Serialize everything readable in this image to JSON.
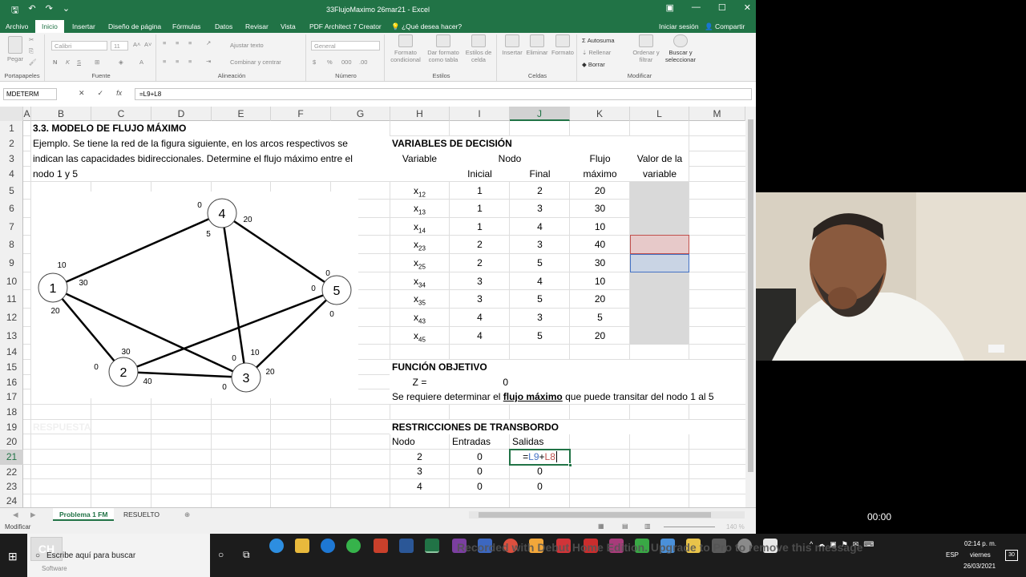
{
  "window": {
    "title": "33FlujoMaximo 26mar21 - Excel",
    "controls": [
      "▣",
      "—",
      "☐",
      "✕"
    ]
  },
  "ribbon_tabs": [
    "Archivo",
    "Inicio",
    "Insertar",
    "Diseño de página",
    "Fórmulas",
    "Datos",
    "Revisar",
    "Vista",
    "PDF Architect 7 Creator",
    "¿Qué desea hacer?"
  ],
  "account": {
    "signin": "Iniciar sesión",
    "share": "Compartir"
  },
  "ribbon": {
    "clipboard": {
      "paste": "Pegar",
      "label": "Portapapeles"
    },
    "font": {
      "name": "Calibri",
      "size": "11",
      "label": "Fuente",
      "bold": "N",
      "italic": "K",
      "underline": "S"
    },
    "alignment": {
      "wrap": "Ajustar texto",
      "merge": "Combinar y centrar",
      "label": "Alineación"
    },
    "number": {
      "format": "General",
      "label": "Número"
    },
    "styles": {
      "conditional": "Formato condicional",
      "as_table": "Dar formato como tabla",
      "cell_styles": "Estilos de celda",
      "label": "Estilos"
    },
    "cells": {
      "insert": "Insertar",
      "delete": "Eliminar",
      "format": "Formato",
      "label": "Celdas"
    },
    "editing": {
      "autosum": "Autosuma",
      "fill": "Rellenar",
      "clear": "Borrar",
      "sort": "Ordenar y filtrar",
      "find": "Buscar y seleccionar",
      "label": "Modificar"
    }
  },
  "formula_bar": {
    "name_box": "MDETERM",
    "fx": "fx",
    "formula": "=L9+L8"
  },
  "columns": [
    "A",
    "B",
    "C",
    "D",
    "E",
    "F",
    "G",
    "H",
    "I",
    "J",
    "K",
    "L",
    "M"
  ],
  "rows": [
    "1",
    "2",
    "3",
    "4",
    "5",
    "6",
    "7",
    "8",
    "9",
    "10",
    "11",
    "12",
    "13",
    "14",
    "15",
    "16",
    "17",
    "18",
    "19",
    "20",
    "21",
    "22",
    "23",
    "24"
  ],
  "sheet": {
    "title": "3.3. MODELO DE FLUJO MÁXIMO",
    "example_l1": "Ejemplo. Se tiene la red de la figura siguiente, en los arcos respectivos se",
    "example_l2": "indican las capacidades bidireccionales. Determine el flujo máximo entre el",
    "example_l3": "nodo 1 y 5",
    "respuesta": "RESPUESTA",
    "vars_title": "VARIABLES DE DECISIÓN",
    "hdr_variable": "Variable",
    "hdr_nodo": "Nodo",
    "hdr_inicial": "Inicial",
    "hdr_final": "Final",
    "hdr_flujo1": "Flujo",
    "hdr_flujo2": "máximo",
    "hdr_valor1": "Valor de la",
    "hdr_valor2": "variable",
    "variables": [
      {
        "name": "x",
        "sub": "12",
        "ini": "1",
        "fin": "2",
        "max": "20"
      },
      {
        "name": "x",
        "sub": "13",
        "ini": "1",
        "fin": "3",
        "max": "30"
      },
      {
        "name": "x",
        "sub": "14",
        "ini": "1",
        "fin": "4",
        "max": "10"
      },
      {
        "name": "x",
        "sub": "23",
        "ini": "2",
        "fin": "3",
        "max": "40"
      },
      {
        "name": "x",
        "sub": "25",
        "ini": "2",
        "fin": "5",
        "max": "30"
      },
      {
        "name": "x",
        "sub": "34",
        "ini": "3",
        "fin": "4",
        "max": "10"
      },
      {
        "name": "x",
        "sub": "35",
        "ini": "3",
        "fin": "5",
        "max": "20"
      },
      {
        "name": "x",
        "sub": "43",
        "ini": "4",
        "fin": "3",
        "max": "5"
      },
      {
        "name": "x",
        "sub": "45",
        "ini": "4",
        "fin": "5",
        "max": "20"
      }
    ],
    "obj_title": "FUNCIÓN OBJETIVO",
    "z_label": "Z =",
    "z_value": "0",
    "requirement_pre": "Se requiere determinar el ",
    "requirement_bold": "flujo máximo",
    "requirement_post": " que puede transitar del nodo 1 al 5",
    "restr_title": "RESTRICCIONES DE TRANSBORDO",
    "restr_hdr_nodo": "Nodo",
    "restr_hdr_entradas": "Entradas",
    "restr_hdr_salidas": "Salidas",
    "restr_rows": [
      {
        "nodo": "2",
        "entradas": "0",
        "salidas_eq": "=",
        "salidas_a": "L9",
        "salidas_plus": "+",
        "salidas_b": "L8"
      },
      {
        "nodo": "3",
        "entradas": "0",
        "salidas": "0"
      },
      {
        "nodo": "4",
        "entradas": "0",
        "salidas": "0"
      }
    ]
  },
  "network": {
    "nodes": [
      "1",
      "2",
      "3",
      "4",
      "5"
    ],
    "labels": [
      "0",
      "20",
      "5",
      "10",
      "30",
      "20",
      "0",
      "0",
      "0",
      "30",
      "0",
      "40",
      "10",
      "0",
      "20",
      "0"
    ]
  },
  "sheet_tabs": [
    "Problema 1 FM",
    "RESUELTO"
  ],
  "status": {
    "mode": "Modificar",
    "zoom": "140 %"
  },
  "webcam": {
    "timer": "00:00"
  },
  "taskbar": {
    "search": "Escribe aquí para buscar",
    "logo_line": "Software",
    "watermark": "Recorded with Debut Home Edition. Upgrade to Pro to remove this message",
    "lang": "ESP",
    "time": "02:14 p. m.",
    "day": "viernes",
    "date": "26/03/2021",
    "notif": "30"
  }
}
